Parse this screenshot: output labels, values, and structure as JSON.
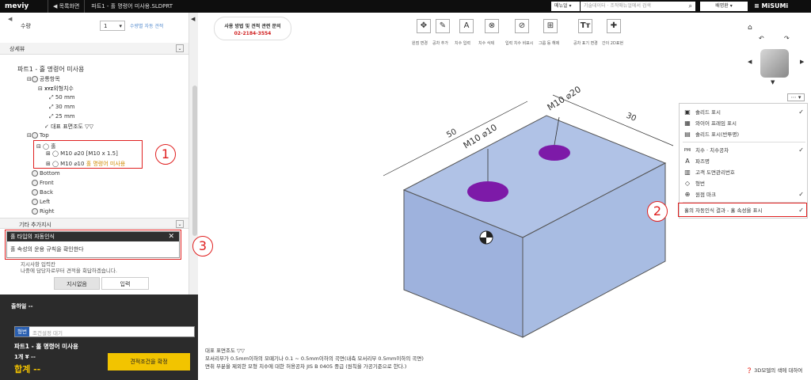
{
  "topbar": {
    "logo": "meviy",
    "back": "◀ 목록화면",
    "filename": "파트1 - 홀 명령어 미사용.SLDPRT",
    "menu_select": "메뉴얼 ▾",
    "search_placeholder": "기술데이터 · 조작매뉴얼에서 검색",
    "user": "배명환 ▾",
    "brand": "MiSUMi"
  },
  "left": {
    "qty_label": "수량",
    "qty_value": "1",
    "qty_link": "수량별 자동 견적",
    "details_title": "상세뷰",
    "tree": [
      {
        "label": "파트1 - 홀 명령어 미사용"
      },
      {
        "label": "공통항목"
      },
      {
        "label": "외형치수"
      },
      {
        "label": "50 mm"
      },
      {
        "label": "30 mm"
      },
      {
        "label": "25 mm"
      },
      {
        "label": "대표 표면조도 ▽▽"
      },
      {
        "label": "Top"
      },
      {
        "label": "홀"
      },
      {
        "label": "M10 ⌀20  [M10 x 1.5]"
      },
      {
        "label": "M10 ⌀10"
      },
      {
        "label": "Bottom"
      },
      {
        "label": "Front"
      },
      {
        "label": "Back"
      },
      {
        "label": "Left"
      },
      {
        "label": "Right"
      }
    ],
    "unused_tag": "홀 명령어 미사용",
    "other_title": "기타 추가지시",
    "toast_title": "홀 타입의 자동인식",
    "toast_body": "홀 속성의 운용 규칙을 확인한다",
    "note_line1": "지시사항 입력칸",
    "note_line2": "나중에 담당자로부터 견적을 회답하겠습니다.",
    "tab1": "지시없음",
    "tab2": "입력",
    "ship_label": "출하일 --",
    "part_tag": "형번",
    "part_placeholder": "조건설정 대기",
    "part_name": "파트1 - 홀 명령어 미사용",
    "unit_price": "1개 ¥ --",
    "total": "합계 --",
    "confirm_button": "견적조건을 확정"
  },
  "viewer": {
    "contact_title": "사용 방법 및 견적 관련 문의",
    "contact_phone": "02-2184-3554",
    "tools": [
      "원점 변경",
      "공차 추가",
      "치수 입력",
      "치수 삭제",
      "입력 치수 비표시",
      "그룹 등 해제",
      "공차 표기 변경",
      "간이 2D표현"
    ],
    "dim_50": "50",
    "dim_30": "30",
    "hole_label_1": "M10 ⌀10",
    "hole_label_2": "M10 ⌀20",
    "menu_items": [
      {
        "label": "솔리드 표시",
        "checked": "✓",
        "icon": "cube-icon"
      },
      {
        "label": "와이어 프레임 표시",
        "checked": "",
        "icon": "wireframe-icon"
      },
      {
        "label": "솔리드 표시(반투명)",
        "checked": "",
        "icon": "translucent-icon"
      },
      {
        "label": "치수 · 치수공차",
        "checked": "✓",
        "icon": "dimension-icon"
      },
      {
        "label": "파즈명",
        "checked": "",
        "icon": "label-icon"
      },
      {
        "label": "고객 도면관리번호",
        "checked": "",
        "icon": "table-icon"
      },
      {
        "label": "형번",
        "checked": "",
        "icon": "tag-icon"
      },
      {
        "label": "원점 마크",
        "checked": "✓",
        "icon": "origin-icon"
      },
      {
        "label": "홀의 자동인식 결과 - 홀 속성을 표시",
        "checked": "✓",
        "icon": ""
      }
    ],
    "note1": "대표 표면조도 ▽▽",
    "note2": "모서리부가 0.5mm이하의 모떼기나 0.1 ~ 0.5mm이하의 곡면(내측 모서리부 0.5mm이하의 곡면)",
    "note3": "면취 부분을 제외한 모형 치수에 대한 허용공차 JIS B 0405 중급 (원칙을 가공기준으로 한다.)",
    "help": "3D모델의 색에 대하여"
  },
  "annotations": [
    "1",
    "2",
    "3"
  ]
}
